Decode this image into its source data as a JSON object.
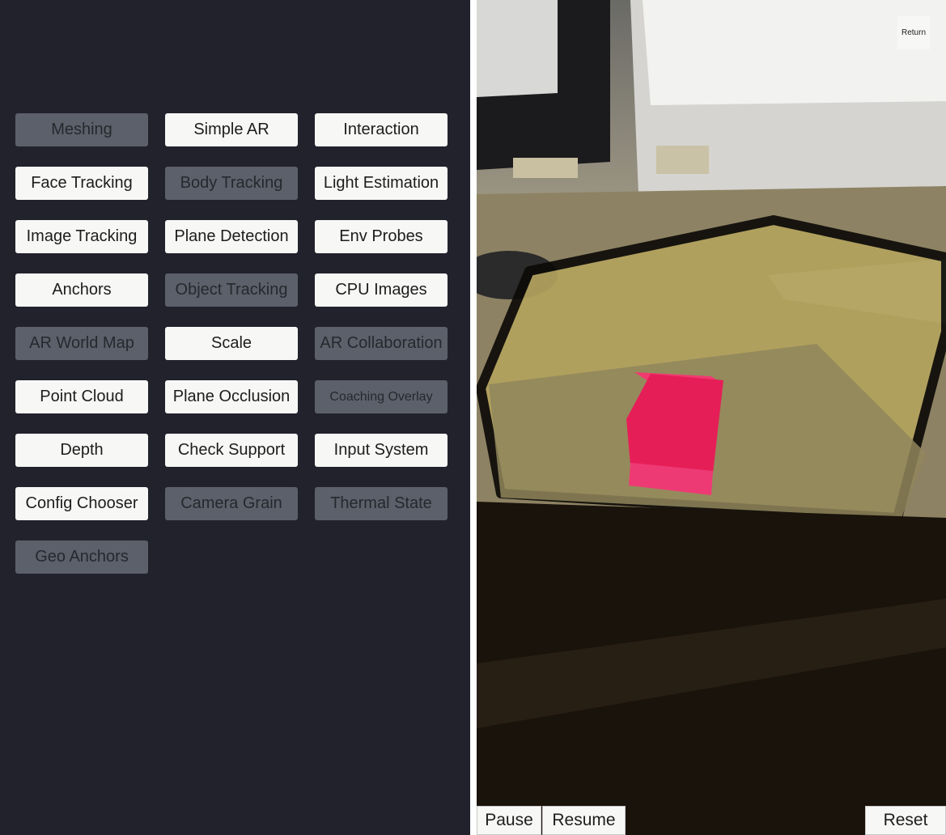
{
  "menu": {
    "buttons": [
      {
        "label": "Meshing",
        "enabled": false
      },
      {
        "label": "Simple AR",
        "enabled": true
      },
      {
        "label": "Interaction",
        "enabled": true
      },
      {
        "label": "Face Tracking",
        "enabled": true
      },
      {
        "label": "Body Tracking",
        "enabled": false
      },
      {
        "label": "Light Estimation",
        "enabled": true
      },
      {
        "label": "Image Tracking",
        "enabled": true
      },
      {
        "label": "Plane Detection",
        "enabled": true
      },
      {
        "label": "Env Probes",
        "enabled": true
      },
      {
        "label": "Anchors",
        "enabled": true
      },
      {
        "label": "Object Tracking",
        "enabled": false
      },
      {
        "label": "CPU Images",
        "enabled": true
      },
      {
        "label": "AR World Map",
        "enabled": false
      },
      {
        "label": "Scale",
        "enabled": true
      },
      {
        "label": "AR Collaboration",
        "enabled": false
      },
      {
        "label": "Point Cloud",
        "enabled": true
      },
      {
        "label": "Plane Occlusion",
        "enabled": true
      },
      {
        "label": "Coaching Overlay",
        "enabled": false
      },
      {
        "label": "Depth",
        "enabled": true
      },
      {
        "label": "Check Support",
        "enabled": true
      },
      {
        "label": "Input System",
        "enabled": true
      },
      {
        "label": "Config Chooser",
        "enabled": true
      },
      {
        "label": "Camera Grain",
        "enabled": false
      },
      {
        "label": "Thermal State",
        "enabled": false
      },
      {
        "label": "Geo Anchors",
        "enabled": false
      }
    ]
  },
  "ar_view": {
    "return_label": "Return",
    "pause_label": "Pause",
    "resume_label": "Resume",
    "reset_label": "Reset",
    "plane_fill_color": "#b3a35e",
    "plane_outline_color": "#0d0b08",
    "cube_color": "#e61e58"
  },
  "colors": {
    "panel_bg": "#22222d",
    "button_enabled_bg": "#f7f7f5",
    "button_disabled_bg": "#5c606a"
  }
}
